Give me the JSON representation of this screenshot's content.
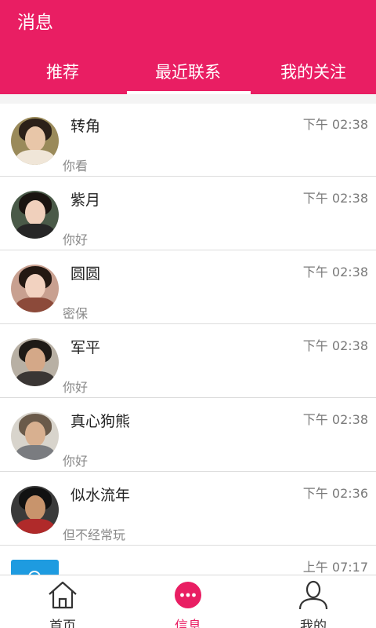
{
  "header": {
    "title": "消息",
    "tabs": [
      {
        "label": "推荐"
      },
      {
        "label": "最近联系",
        "active": true
      },
      {
        "label": "我的关注"
      }
    ],
    "accent_color": "#e91e63"
  },
  "conversations": [
    {
      "name": "转角",
      "message": "你看",
      "time": "下午 02:38"
    },
    {
      "name": "紫月",
      "message": "你好",
      "time": "下午 02:38"
    },
    {
      "name": "圆圆",
      "message": "密保",
      "time": "下午 02:38"
    },
    {
      "name": "军平",
      "message": "你好",
      "time": "下午 02:38"
    },
    {
      "name": "真心狗熊",
      "message": "你好",
      "time": "下午 02:38"
    },
    {
      "name": "似水流年",
      "message": "但不经常玩",
      "time": "下午 02:36"
    },
    {
      "name": "",
      "message": "",
      "time": "上午 07:17",
      "icon": "app-icon"
    }
  ],
  "bottom_nav": [
    {
      "label": "首页",
      "icon": "home-icon"
    },
    {
      "label": "信息",
      "icon": "chat-bubble-icon",
      "active": true
    },
    {
      "label": "我的",
      "icon": "user-icon"
    }
  ]
}
